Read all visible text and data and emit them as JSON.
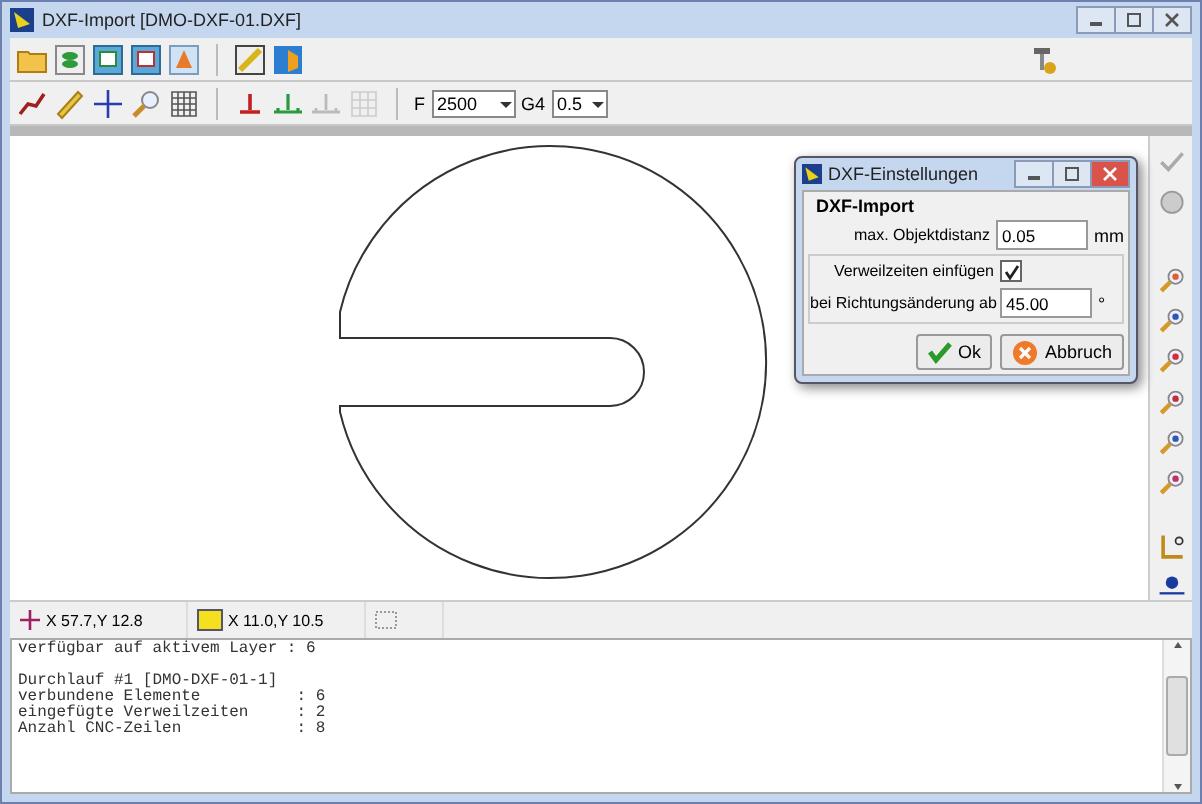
{
  "window": {
    "title": "DXF-Import [DMO-DXF-01.DXF]"
  },
  "toolbar2": {
    "feed_label": "F",
    "feed_value": "2500",
    "dwell_label": "G4",
    "dwell_value": "0.5"
  },
  "status_bar": {
    "cursor": "X 57.7,Y 12.8",
    "origin": "X 11.0,Y 10.5"
  },
  "dialog": {
    "title": "DXF-Einstellungen",
    "section": "DXF-Import",
    "distance_label": "max. Objektdistanz",
    "distance_value": "0.05",
    "distance_unit": "mm",
    "dwell_label": "Verweilzeiten einfügen",
    "dwell_checked": true,
    "angle_label": "bei Richtungsänderung ab",
    "angle_value": "45.00",
    "angle_unit": "°",
    "buttons": [
      {
        "kind": "ok",
        "label": "Ok"
      },
      {
        "kind": "cancel",
        "label": "Abbruch"
      }
    ]
  },
  "log": [
    [
      "verfügbar auf aktivem Layer : 6"
    ],
    [
      "Durchlauf #1 [DMO-DXF-01-1]",
      "verbundene Elemente          : 6",
      "eingefügte Verweilzeiten     : 2",
      "Anzahl CNC-Zeilen            : 8"
    ]
  ]
}
